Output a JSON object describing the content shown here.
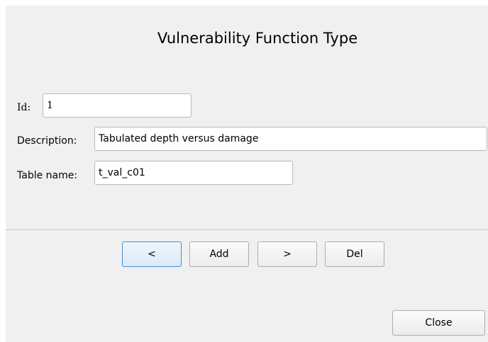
{
  "dialog": {
    "title": "Vulnerability Function Type"
  },
  "form": {
    "id_label": "Id:",
    "id_value": "1",
    "description_label": "Description:",
    "description_value": "Tabulated depth versus damage",
    "table_label": "Table name:",
    "table_value": "t_val_c01"
  },
  "nav": {
    "prev_label": "<",
    "add_label": "Add",
    "next_label": ">",
    "del_label": "Del"
  },
  "footer": {
    "close_label": "Close"
  },
  "colors": {
    "dialog_bg": "#f0f0f0",
    "focus_border": "#3f8fd6"
  }
}
